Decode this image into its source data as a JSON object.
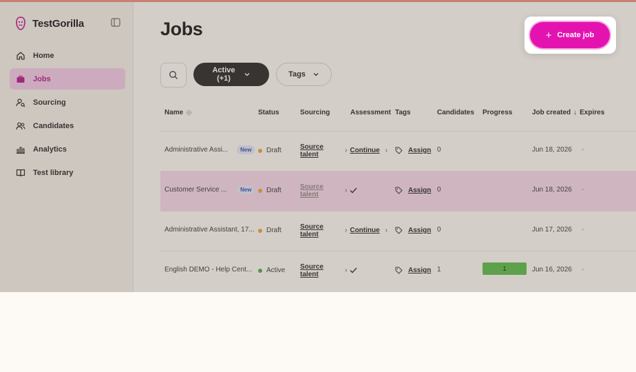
{
  "app": {
    "name": "TestGorilla"
  },
  "sidebar": {
    "items": [
      {
        "label": "Home",
        "icon": "home-icon"
      },
      {
        "label": "Jobs",
        "icon": "briefcase-icon",
        "active": true
      },
      {
        "label": "Sourcing",
        "icon": "user-search-icon"
      },
      {
        "label": "Candidates",
        "icon": "users-icon"
      },
      {
        "label": "Analytics",
        "icon": "bar-chart-icon"
      },
      {
        "label": "Test library",
        "icon": "book-icon"
      }
    ]
  },
  "page": {
    "title": "Jobs",
    "create_label": "Create job"
  },
  "filters": {
    "active_label": "Active",
    "active_count": "(+1)",
    "tags_label": "Tags"
  },
  "table": {
    "columns": {
      "name": "Name",
      "status": "Status",
      "sourcing": "Sourcing",
      "assessment": "Assessment",
      "tags": "Tags",
      "candidates": "Candidates",
      "progress": "Progress",
      "job_created": "Job created",
      "expires": "Expires"
    },
    "rows": [
      {
        "name": "Administrative Assi...",
        "new_badge": "New",
        "status": "Draft",
        "sourcing_line1": "Source",
        "sourcing_line2": "talent",
        "assessment": "Continue",
        "tags": "Assign",
        "candidates": "0",
        "progress": "",
        "created": "Jun 18, 2026",
        "expires": "-"
      },
      {
        "name": "Customer Service ...",
        "new_badge": "New",
        "status": "Draft",
        "sourcing_line1": "Source",
        "sourcing_line2": "talent",
        "assessment": "",
        "tags": "Assign",
        "candidates": "0",
        "progress": "",
        "created": "Jun 18, 2026",
        "expires": "-"
      },
      {
        "name": "Administrative Assistant, 17...",
        "new_badge": "",
        "status": "Draft",
        "sourcing_line1": "Source",
        "sourcing_line2": "talent",
        "assessment": "Continue",
        "tags": "Assign",
        "candidates": "0",
        "progress": "",
        "created": "Jun 17, 2026",
        "expires": "-"
      },
      {
        "name": "English DEMO - Help Cent...",
        "new_badge": "",
        "status": "Active",
        "sourcing_line1": "Source",
        "sourcing_line2": "talent",
        "assessment": "",
        "tags": "Assign",
        "candidates": "1",
        "progress": "1",
        "created": "Jun 16, 2026",
        "expires": "-"
      }
    ]
  },
  "colors": {
    "accent": "#e413b0",
    "draft": "#e6a12c",
    "active": "#3fae3a",
    "progress": "#58b947"
  }
}
